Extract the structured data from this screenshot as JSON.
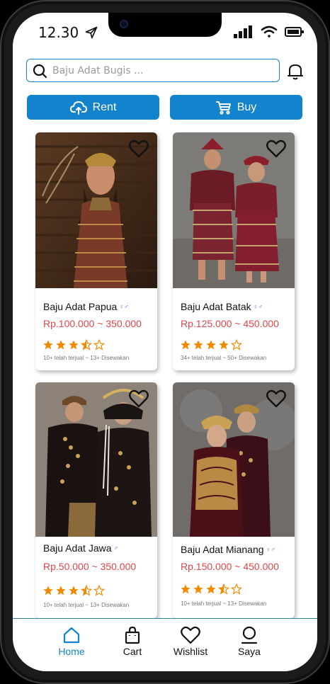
{
  "status": {
    "time": "12.30"
  },
  "search": {
    "placeholder": "Baju Adat Bugis ..."
  },
  "actions": {
    "rent_label": "Rent",
    "buy_label": "Buy"
  },
  "products": [
    {
      "name": "Baju Adat Papua",
      "price": "Rp.100.000 ~ 350.000",
      "rating": 3.5,
      "sold": "10+ telah terjual ~ 13+ Disewakan"
    },
    {
      "name": "Baju Adat Batak",
      "price": "Rp.125.000 ~ 450.000",
      "rating": 4,
      "sold": "34+ telah terjual ~ 50+ Disewakan"
    },
    {
      "name": "Baju Adat Jawa",
      "price": "Rp.50.000 ~ 350.000",
      "rating": 3.5,
      "sold": "10+ telah terjual ~ 13+ Disewakan"
    },
    {
      "name": "Baju Adat Mianang",
      "price": "Rp.150.000 ~ 450.000",
      "rating": 3.5,
      "sold": "10+ telah terjual ~ 13+ Disewakan"
    }
  ],
  "nav": {
    "home": "Home",
    "cart": "Cart",
    "wishlist": "Wishlist",
    "saya": "Saya"
  },
  "colors": {
    "accent": "#1283cc",
    "price": "#e0474c",
    "star": "#f08a00"
  },
  "icons": [
    "send-icon",
    "signal-icon",
    "wifi-icon",
    "battery-icon",
    "search-icon",
    "bell-icon",
    "cloud-upload-icon",
    "cart-icon",
    "heart-icon",
    "star-icon",
    "home-icon",
    "bag-icon",
    "user-icon"
  ]
}
